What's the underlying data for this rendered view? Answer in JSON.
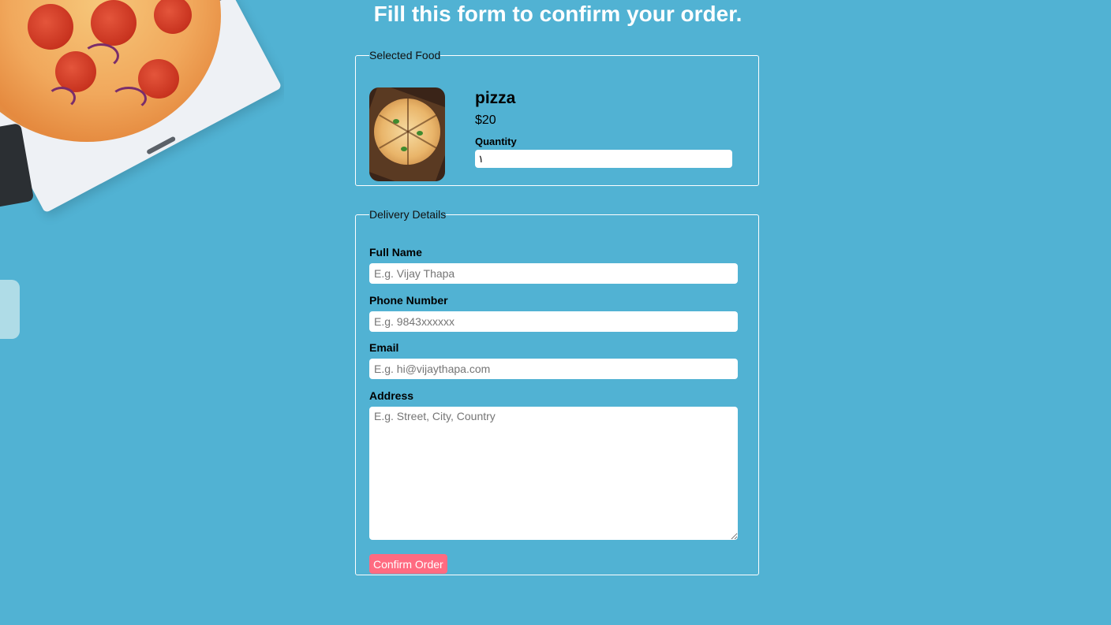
{
  "page": {
    "title": "Fill this form to confirm your order."
  },
  "selected_food": {
    "legend": "Selected Food",
    "name": "pizza",
    "price": "$20",
    "quantity_label": "Quantity",
    "quantity_value": "١"
  },
  "delivery": {
    "legend": "Delivery Details",
    "full_name": {
      "label": "Full Name",
      "placeholder": "E.g. Vijay Thapa"
    },
    "phone": {
      "label": "Phone Number",
      "placeholder": "E.g. 9843xxxxxx"
    },
    "email": {
      "label": "Email",
      "placeholder": "E.g. hi@vijaythapa.com"
    },
    "address": {
      "label": "Address",
      "placeholder": "E.g. Street, City, Country"
    },
    "confirm_label": "Confirm Order"
  },
  "colors": {
    "background": "#51b2d3",
    "button": "#ff6b81",
    "border": "#ffffff"
  }
}
